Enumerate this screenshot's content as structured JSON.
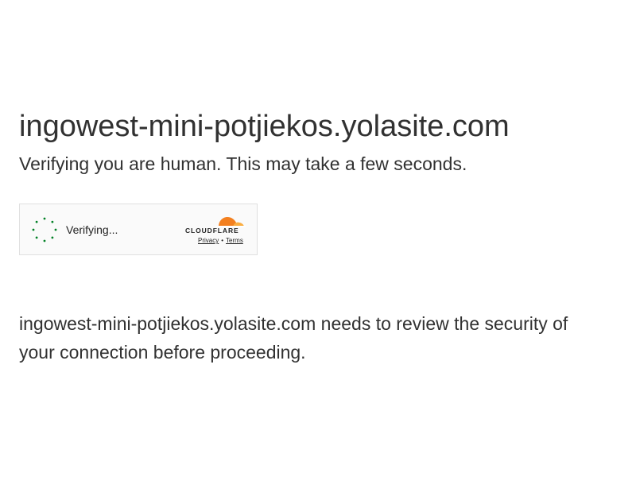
{
  "page": {
    "site_name": "ingowest-mini-potjiekos.yolasite.com",
    "subtitle": "Verifying you are human. This may take a few seconds.",
    "security_message_suffix": " needs to review the security of your connection before proceeding."
  },
  "widget": {
    "status_text": "Verifying...",
    "spinner_icon": "loading-spinner-icon",
    "brand_icon": "cloudflare-logo",
    "brand_text": "CLOUDFLARE",
    "privacy_link": "Privacy",
    "separator": "•",
    "terms_link": "Terms"
  },
  "colors": {
    "text": "#313131",
    "spinner": "#038127",
    "cloudflare_orange": "#f38020",
    "cloudflare_light_orange": "#faae40",
    "widget_bg": "#fafafa",
    "widget_border": "#e0e0e0"
  }
}
